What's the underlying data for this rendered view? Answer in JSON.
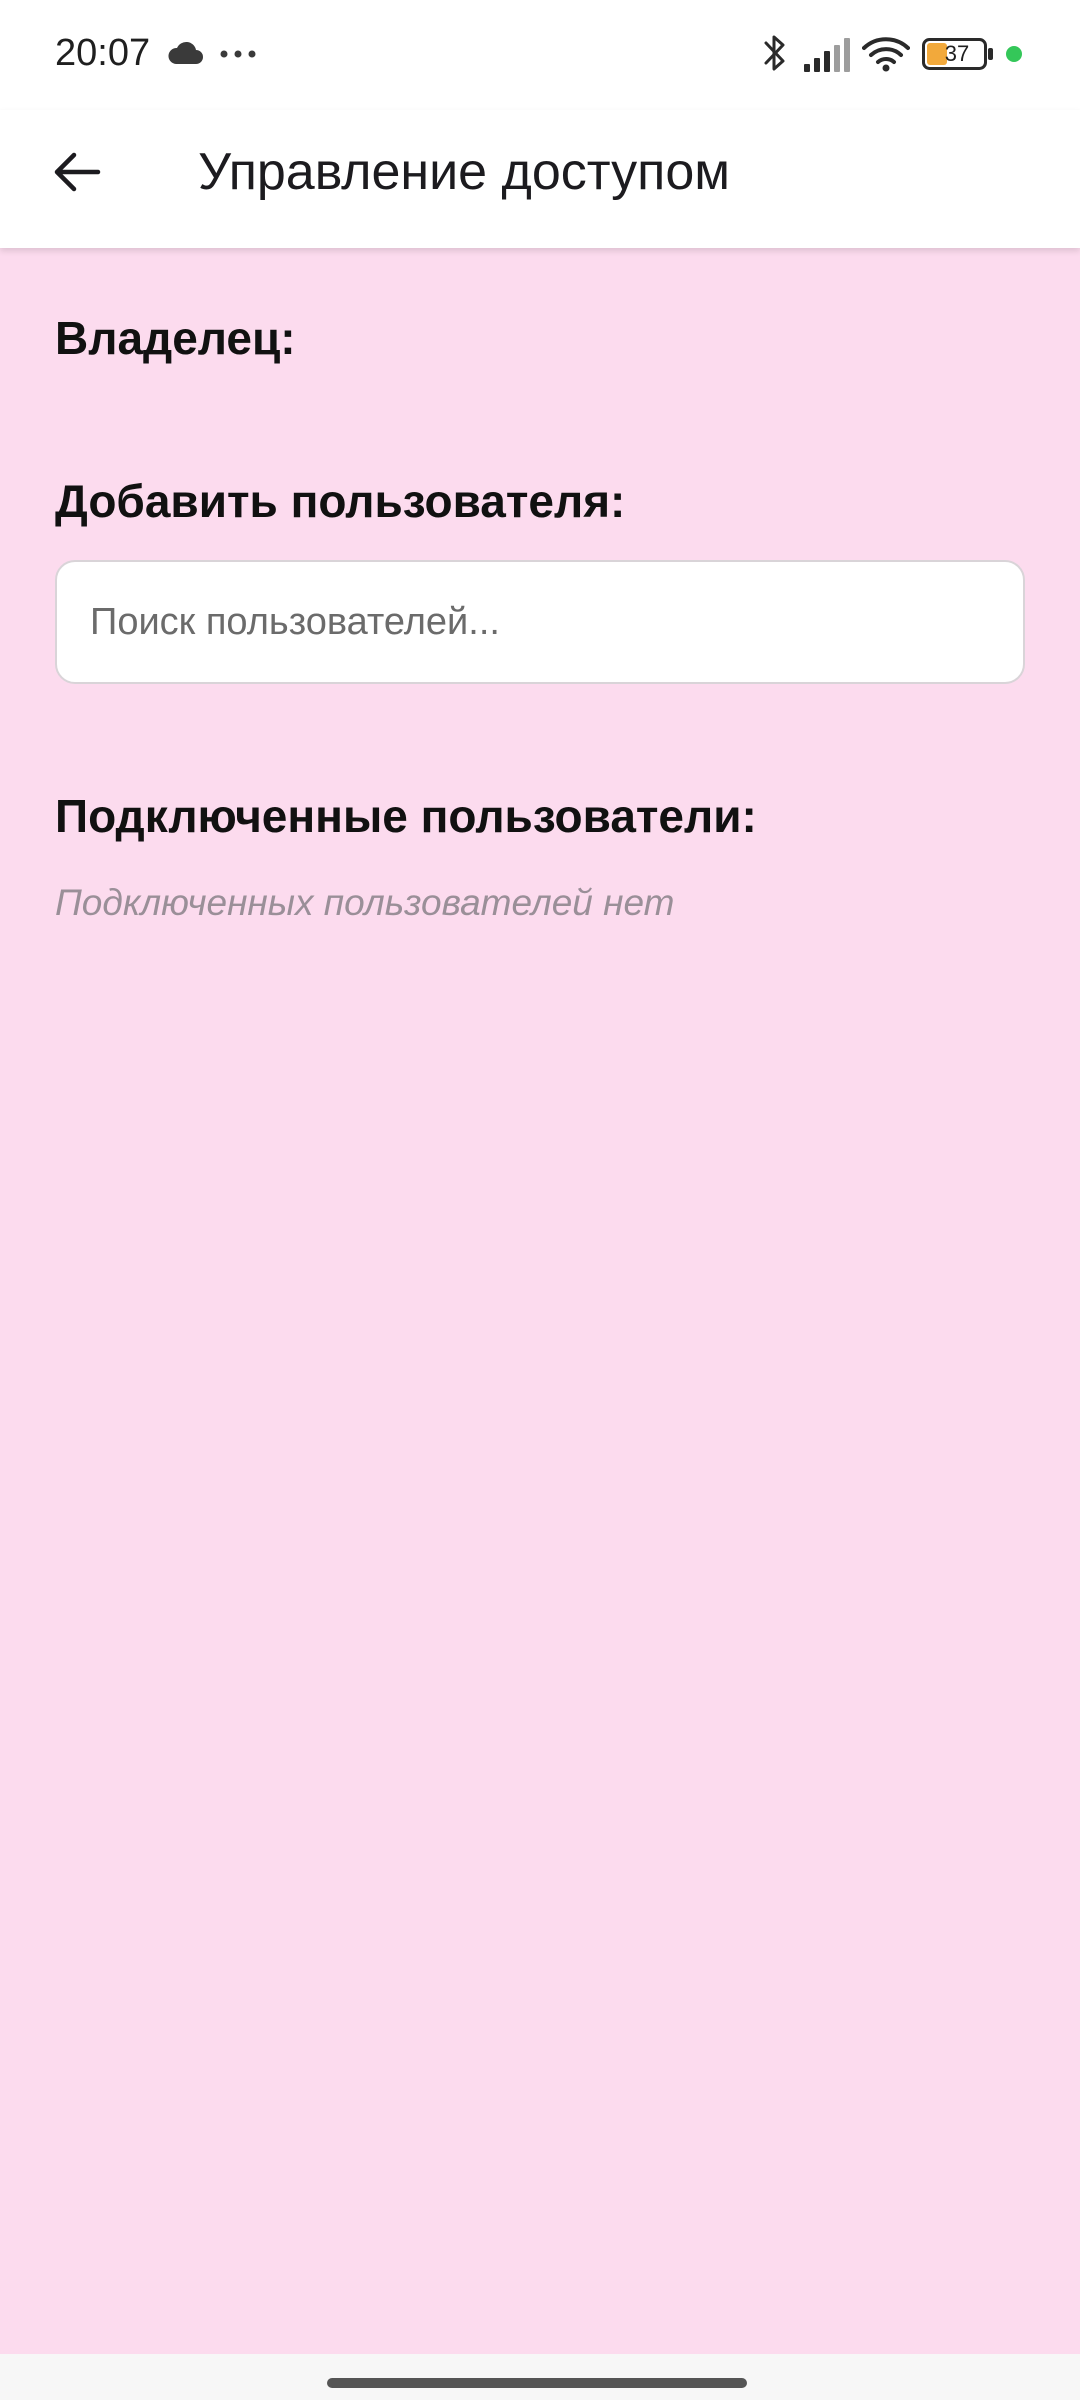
{
  "status_bar": {
    "time": "20:07",
    "battery_level": "37",
    "icons": [
      "cloud-icon",
      "more-icon",
      "bluetooth-icon",
      "signal-icon",
      "wifi-icon",
      "battery-icon"
    ]
  },
  "app_bar": {
    "back_icon": "arrow-back-icon",
    "title": "Управление доступом"
  },
  "sections": {
    "owner_label": "Владелец:",
    "add_user_label": "Добавить пользователя:",
    "search": {
      "placeholder": "Поиск пользователей...",
      "value": ""
    },
    "connected_label": "Подключенные пользователи:",
    "connected_empty": "Подключенных пользователей нет"
  },
  "colors": {
    "content_background": "#fcdbee",
    "app_bar_background": "#ffffff",
    "battery_fill": "#f2a93b",
    "privacy_dot": "#34c759",
    "muted_text": "#9a8f98"
  }
}
